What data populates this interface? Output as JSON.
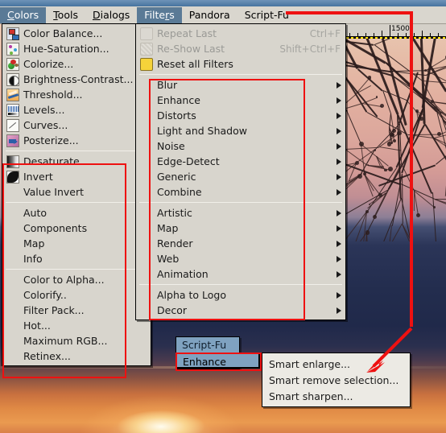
{
  "menubar": {
    "items": [
      {
        "label": "Colors",
        "mnemonic": "C",
        "selected": true
      },
      {
        "label": "Tools",
        "mnemonic": "T",
        "selected": false
      },
      {
        "label": "Dialogs",
        "mnemonic": "D",
        "selected": false
      },
      {
        "label": "Filters",
        "mnemonic": "r",
        "selected": true
      },
      {
        "label": "Pandora",
        "mnemonic": "",
        "selected": false
      },
      {
        "label": "Script-Fu",
        "mnemonic": "",
        "selected": false
      }
    ]
  },
  "colors_menu": {
    "name": "Colors",
    "groups": [
      {
        "items": [
          {
            "label": "Color Balance...",
            "icon": "color-balance-icon"
          },
          {
            "label": "Hue-Saturation...",
            "icon": "hue-saturation-icon"
          },
          {
            "label": "Colorize...",
            "icon": "colorize-icon"
          },
          {
            "label": "Brightness-Contrast...",
            "icon": "brightness-contrast-icon"
          },
          {
            "label": "Threshold...",
            "icon": "threshold-icon"
          },
          {
            "label": "Levels...",
            "icon": "levels-icon"
          },
          {
            "label": "Curves...",
            "icon": "curves-icon"
          },
          {
            "label": "Posterize...",
            "icon": "posterize-icon"
          }
        ]
      },
      {
        "items": [
          {
            "label": "Desaturate...",
            "icon": "desaturate-icon"
          },
          {
            "label": "Invert",
            "icon": "invert-icon"
          },
          {
            "label": "Value Invert",
            "icon": ""
          }
        ]
      },
      {
        "items": [
          {
            "label": "Auto",
            "icon": "",
            "submenu": true
          },
          {
            "label": "Components",
            "icon": "",
            "submenu": true
          },
          {
            "label": "Map",
            "icon": "",
            "submenu": true
          },
          {
            "label": "Info",
            "icon": "",
            "submenu": true
          }
        ]
      },
      {
        "items": [
          {
            "label": "Color to Alpha...",
            "icon": ""
          },
          {
            "label": "Colorify..",
            "icon": ""
          },
          {
            "label": "Filter Pack...",
            "icon": ""
          },
          {
            "label": "Hot...",
            "icon": ""
          },
          {
            "label": "Maximum RGB...",
            "icon": ""
          },
          {
            "label": "Retinex...",
            "icon": ""
          }
        ]
      }
    ]
  },
  "filters_menu": {
    "name": "Filters",
    "groups": [
      {
        "items": [
          {
            "label": "Repeat Last",
            "accel": "Ctrl+F",
            "disabled": true,
            "icon": "repeat-last-icon"
          },
          {
            "label": "Re-Show Last",
            "accel": "Shift+Ctrl+F",
            "disabled": true,
            "icon": "reshow-last-icon"
          },
          {
            "label": "Reset all Filters",
            "accel": "",
            "disabled": false,
            "icon": "reset-filters-icon"
          }
        ]
      },
      {
        "items": [
          {
            "label": "Blur",
            "submenu": true
          },
          {
            "label": "Enhance",
            "submenu": true
          },
          {
            "label": "Distorts",
            "submenu": true
          },
          {
            "label": "Light and Shadow",
            "submenu": true
          },
          {
            "label": "Noise",
            "submenu": true
          },
          {
            "label": "Edge-Detect",
            "submenu": true
          },
          {
            "label": "Generic",
            "submenu": true
          },
          {
            "label": "Combine",
            "submenu": true
          }
        ]
      },
      {
        "items": [
          {
            "label": "Artistic",
            "submenu": true
          },
          {
            "label": "Map",
            "submenu": true
          },
          {
            "label": "Render",
            "submenu": true
          },
          {
            "label": "Web",
            "submenu": true
          },
          {
            "label": "Animation",
            "submenu": true
          }
        ]
      },
      {
        "items": [
          {
            "label": "Alpha to Logo",
            "submenu": true
          },
          {
            "label": "Decor",
            "submenu": true
          }
        ]
      }
    ]
  },
  "scriptfu_menu": {
    "title": "Script-Fu",
    "selected_item": "Enhance",
    "submenu_items": [
      {
        "label": "Smart enlarge..."
      },
      {
        "label": "Smart remove selection..."
      },
      {
        "label": "Smart sharpen..."
      }
    ]
  },
  "ruler": {
    "labels": [
      "1500"
    ]
  },
  "annotations": {
    "accent_color": "#ee1111",
    "highlight_color": "#5a7a96",
    "menu_bg": "#d8d5cd"
  }
}
